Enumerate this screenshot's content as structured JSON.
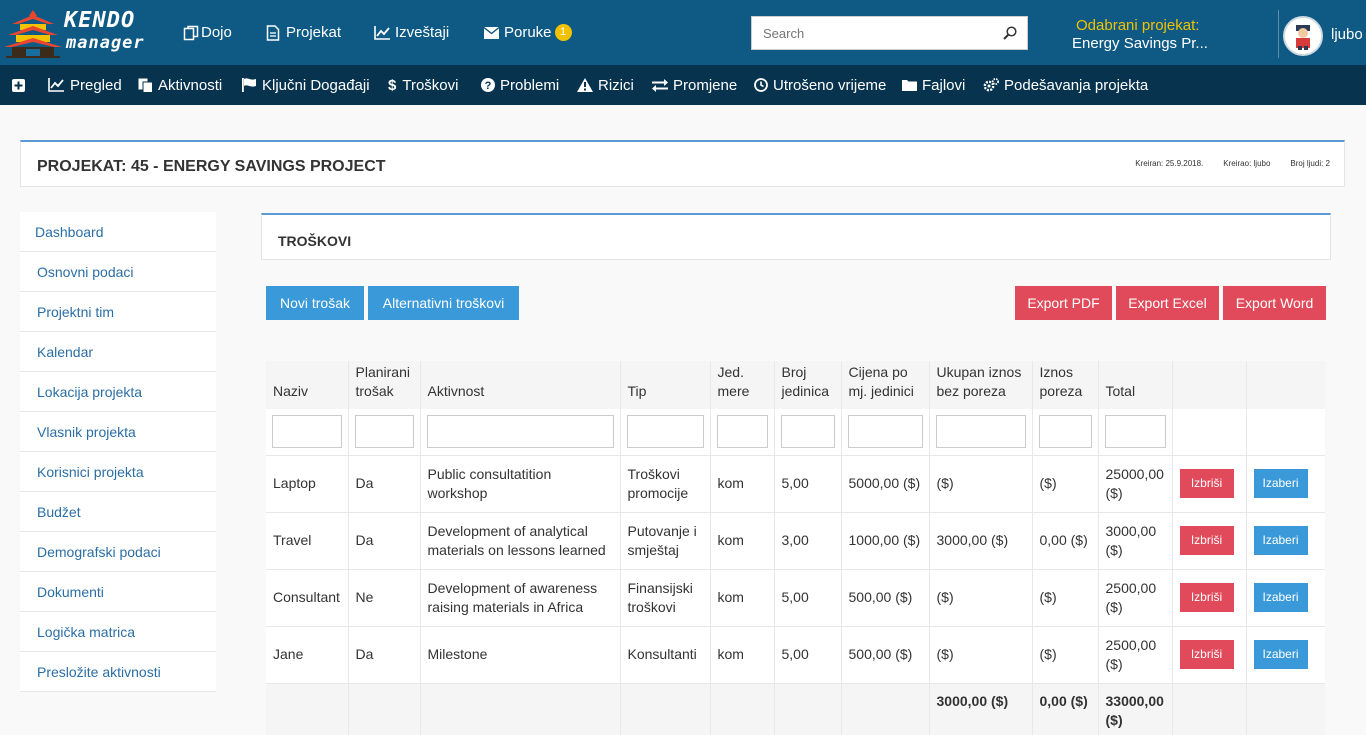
{
  "brand": {
    "line1": "KENDO",
    "line2": "manager"
  },
  "topnav": [
    {
      "label": "Dojo",
      "icon": "copy-icon"
    },
    {
      "label": "Projekat",
      "icon": "file-icon"
    },
    {
      "label": "Izveštaji",
      "icon": "line-chart-icon"
    },
    {
      "label": "Poruke",
      "icon": "envelope-icon",
      "badge": "1"
    }
  ],
  "search": {
    "placeholder": "Search",
    "value": ""
  },
  "selected_project": {
    "label": "Odabrani projekat:",
    "value": "Energy Savings Pr..."
  },
  "user": {
    "name": "ljubo"
  },
  "subnav": [
    {
      "label": "",
      "icon": "plus-square-icon"
    },
    {
      "label": "Pregled",
      "icon": "line-chart-icon"
    },
    {
      "label": "Aktivnosti",
      "icon": "files-icon"
    },
    {
      "label": "Ključni Događaji",
      "icon": "flag-icon"
    },
    {
      "label": "Troškovi",
      "icon": "dollar-icon"
    },
    {
      "label": "Problemi",
      "icon": "question-circle-icon"
    },
    {
      "label": "Rizici",
      "icon": "warning-icon"
    },
    {
      "label": "Promjene",
      "icon": "exchange-icon"
    },
    {
      "label": "Utrošeno vrijeme",
      "icon": "clock-icon"
    },
    {
      "label": "Fajlovi",
      "icon": "folder-icon"
    },
    {
      "label": "Podešavanja projekta",
      "icon": "cogs-icon"
    }
  ],
  "project": {
    "title": "PROJEKAT: 45 - ENERGY SAVINGS PROJECT",
    "created": "Kreiran: 25.9.2018.",
    "creator": "Kreirao: ljubo",
    "people": "Broj ljudi: 2"
  },
  "sidebar": [
    "Dashboard",
    "Osnovni podaci",
    "Projektni tim",
    "Kalendar",
    "Lokacija projekta",
    "Vlasnik projekta",
    "Korisnici projekta",
    "Budžet",
    "Demografski podaci",
    "Dokumenti",
    "Logička matrica",
    "Presložite aktivnosti"
  ],
  "panel": {
    "title": "TROŠKOVI"
  },
  "buttons": {
    "new_cost": "Novi trošak",
    "alt_costs": "Alternativni troškovi",
    "export_pdf": "Export PDF",
    "export_excel": "Export Excel",
    "export_word": "Export Word"
  },
  "table": {
    "headers": [
      "Naziv",
      "Planirani trošak",
      "Aktivnost",
      "Tip",
      "Jed. mere",
      "Broj jedinica",
      "Cijena po mj. jedinici",
      "Ukupan iznos bez poreza",
      "Iznos poreza",
      "Total",
      "",
      ""
    ],
    "rows": [
      [
        "Laptop",
        "Da",
        "Public consultatition workshop",
        "Troškovi promocije",
        "kom",
        "5,00",
        "5000,00 ($)",
        "($)",
        "($)",
        "25000,00 ($)"
      ],
      [
        "Travel",
        "Da",
        "Development of analytical materials on lessons learned",
        "Putovanje i smještaj",
        "kom",
        "3,00",
        "1000,00 ($)",
        "3000,00 ($)",
        "0,00 ($)",
        "3000,00 ($)"
      ],
      [
        "Consultant",
        "Ne",
        "Development of awareness raising materials in Africa",
        "Finansijski troškovi",
        "kom",
        "5,00",
        "500,00 ($)",
        "($)",
        "($)",
        "2500,00 ($)"
      ],
      [
        "Jane",
        "Da",
        "Milestone",
        "Konsultanti",
        "kom",
        "5,00",
        "500,00 ($)",
        "($)",
        "($)",
        "2500,00 ($)"
      ]
    ],
    "row_actions": {
      "delete": "Izbriši",
      "select": "Izaberi"
    },
    "totals": {
      "without_tax": "3000,00 ($)",
      "tax": "0,00 ($)",
      "total": "33000,00 ($)"
    }
  }
}
